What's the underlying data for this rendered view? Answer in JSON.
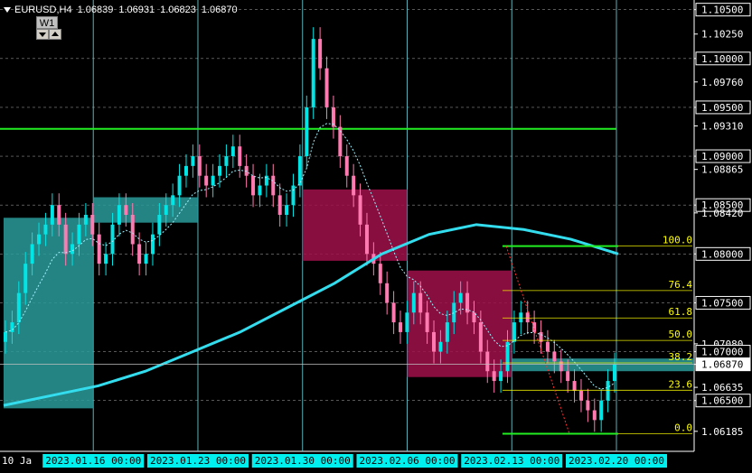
{
  "header": {
    "symbol": "EURUSD,H4",
    "open": "1.06839",
    "high": "1.06931",
    "low": "1.06823",
    "close": "1.06870"
  },
  "timeframe_button": "W1",
  "price_labels": [
    {
      "price": 1.105,
      "text": "1.10500",
      "boxed": true
    },
    {
      "price": 1.1025,
      "text": "1.10250",
      "boxed": false
    },
    {
      "price": 1.1,
      "text": "1.10000",
      "boxed": true
    },
    {
      "price": 1.0976,
      "text": "1.09760",
      "boxed": false
    },
    {
      "price": 1.095,
      "text": "1.09500",
      "boxed": true
    },
    {
      "price": 1.0931,
      "text": "1.09310",
      "boxed": false
    },
    {
      "price": 1.09,
      "text": "1.09000",
      "boxed": true
    },
    {
      "price": 1.08865,
      "text": "1.08865",
      "boxed": false
    },
    {
      "price": 1.085,
      "text": "1.08500",
      "boxed": true
    },
    {
      "price": 1.0842,
      "text": "1.08420",
      "boxed": false
    },
    {
      "price": 1.08,
      "text": "1.08000",
      "boxed": true
    },
    {
      "price": 1.075,
      "text": "1.07500",
      "boxed": true
    },
    {
      "price": 1.0708,
      "text": "1.07080",
      "boxed": false
    },
    {
      "price": 1.07,
      "text": "1.07000",
      "boxed": true
    },
    {
      "price": 1.0687,
      "text": "1.06870",
      "boxed": true,
      "current": true
    },
    {
      "price": 1.06635,
      "text": "1.06635",
      "boxed": false
    },
    {
      "price": 1.065,
      "text": "1.06500",
      "boxed": true
    },
    {
      "price": 1.06185,
      "text": "1.06185",
      "boxed": false
    }
  ],
  "time_labels": [
    {
      "date": "2023-01-10",
      "text": "10 Ja",
      "highlight": false
    },
    {
      "date": "2023-01-16",
      "text": "2023.01.16 00:00",
      "highlight": true
    },
    {
      "date": "2023-01-23",
      "text": "2023.01.23 00:00",
      "highlight": true
    },
    {
      "date": "2023-01-30",
      "text": "2023.01.30 00:00",
      "highlight": true
    },
    {
      "date": "2023-02-06",
      "text": "2023.02.06 00:00",
      "highlight": true
    },
    {
      "date": "2023-02-13",
      "text": "2023.02.13 00:00",
      "highlight": true
    },
    {
      "date": "2023-02-20",
      "text": "2023.02.20 00:00",
      "highlight": true
    }
  ],
  "fibo_levels": [
    {
      "label": "100.0",
      "price": 1.0808
    },
    {
      "label": "76.4",
      "price": 1.07625
    },
    {
      "label": "61.8",
      "price": 1.07345
    },
    {
      "label": "50.0",
      "price": 1.07115
    },
    {
      "label": "38.2",
      "price": 1.06885
    },
    {
      "label": "23.6",
      "price": 1.06605
    },
    {
      "label": "0.0",
      "price": 1.0616
    }
  ],
  "horizontal_line_price": 1.0928,
  "colors": {
    "bull": "#00e5e5",
    "bear": "#ff7ab0",
    "ma": "#33ddee",
    "green_line": "#22ee22",
    "fibo": "#ffff00",
    "axis_label_bg": "#00f0f0",
    "grid": "#ffffff",
    "vline": "#6ad0d8"
  },
  "chart_data": {
    "type": "candlestick",
    "symbol": "EURUSD",
    "timeframe": "H4",
    "ylim": [
      1.0598,
      1.1058
    ],
    "candles_close": [
      1.072,
      1.073,
      1.076,
      1.079,
      1.081,
      1.082,
      1.083,
      1.085,
      1.083,
      1.08,
      1.081,
      1.083,
      1.084,
      1.082,
      1.079,
      1.08,
      1.083,
      1.085,
      1.084,
      1.081,
      1.079,
      1.08,
      1.082,
      1.084,
      1.085,
      1.086,
      1.088,
      1.089,
      1.09,
      1.088,
      1.087,
      1.088,
      1.089,
      1.09,
      1.091,
      1.089,
      1.088,
      1.086,
      1.087,
      1.088,
      1.086,
      1.084,
      1.085,
      1.087,
      1.09,
      1.095,
      1.102,
      1.099,
      1.095,
      1.093,
      1.09,
      1.088,
      1.086,
      1.083,
      1.08,
      1.079,
      1.077,
      1.075,
      1.073,
      1.072,
      1.074,
      1.076,
      1.074,
      1.072,
      1.07,
      1.071,
      1.073,
      1.075,
      1.076,
      1.074,
      1.073,
      1.07,
      1.068,
      1.067,
      1.068,
      1.071,
      1.073,
      1.074,
      1.073,
      1.072,
      1.071,
      1.07,
      1.069,
      1.068,
      1.067,
      1.066,
      1.065,
      1.064,
      1.063,
      1.065,
      1.067,
      1.0687
    ],
    "moving_average_slow": [
      1.0645,
      1.0655,
      1.0665,
      1.068,
      1.07,
      1.072,
      1.0745,
      1.077,
      1.08,
      1.082,
      1.083,
      1.0825,
      1.0815,
      1.08
    ],
    "fibonacci_retracement": {
      "high": 1.0808,
      "low": 1.0616
    }
  }
}
